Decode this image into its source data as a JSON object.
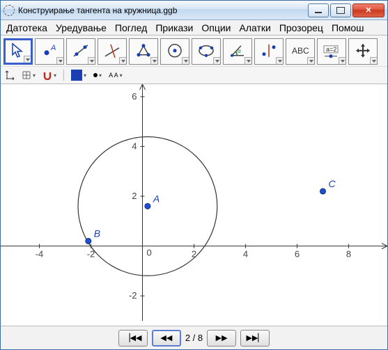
{
  "window": {
    "title": "Конструирање тангента на кружница.ggb"
  },
  "menu": {
    "items": [
      "Датотека",
      "Уредување",
      "Поглед",
      "Прикази",
      "Опции",
      "Алатки",
      "Прозорец",
      "Помош"
    ]
  },
  "toolbar": {
    "tools": [
      {
        "name": "move-arrow",
        "selected": true
      },
      {
        "name": "point"
      },
      {
        "name": "line"
      },
      {
        "name": "perpendicular"
      },
      {
        "name": "polygon"
      },
      {
        "name": "circle-center"
      },
      {
        "name": "circle-3pts"
      },
      {
        "name": "angle"
      },
      {
        "name": "reflect"
      },
      {
        "name": "text",
        "label": "ABC"
      },
      {
        "name": "slider",
        "label": "a=2"
      },
      {
        "name": "move-view"
      }
    ]
  },
  "style_bar": {
    "accent_color": "#1a3fb0"
  },
  "navigation": {
    "step_label": "2 / 8"
  },
  "chart_data": {
    "type": "scatter",
    "title": "",
    "xlabel": "",
    "ylabel": "",
    "xlim": [
      -5.5,
      9.5
    ],
    "ylim": [
      -3,
      6.5
    ],
    "x_ticks": [
      -4,
      -2,
      2,
      4,
      6,
      8
    ],
    "y_ticks": [
      -2,
      2,
      4,
      6
    ],
    "origin_label": "0",
    "points": [
      {
        "name": "A",
        "x": 0.2,
        "y": 1.6
      },
      {
        "name": "B",
        "x": -2.1,
        "y": 0.2
      },
      {
        "name": "C",
        "x": 7.0,
        "y": 2.2
      }
    ],
    "circle": {
      "cx": 0.2,
      "cy": 1.6,
      "r": 2.7
    }
  }
}
